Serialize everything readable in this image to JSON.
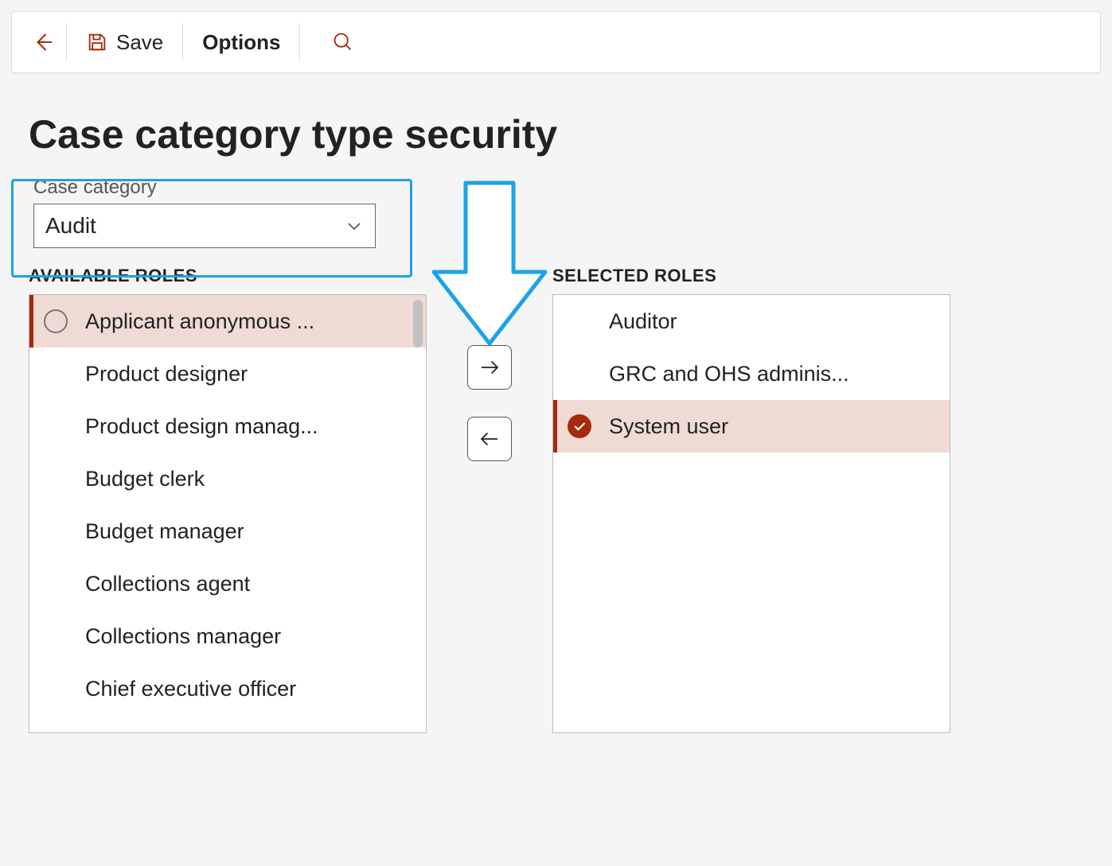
{
  "toolbar": {
    "save_label": "Save",
    "options_label": "Options"
  },
  "page": {
    "title": "Case category type security"
  },
  "field": {
    "label": "Case category",
    "value": "Audit"
  },
  "available": {
    "header": "AVAILABLE ROLES",
    "items": [
      "Applicant anonymous ...",
      "Product designer",
      "Product design manag...",
      "Budget clerk",
      "Budget manager",
      "Collections agent",
      "Collections manager",
      "Chief executive officer"
    ]
  },
  "selected": {
    "header": "SELECTED ROLES",
    "items": [
      "Auditor",
      "GRC and OHS adminis...",
      "System user"
    ]
  },
  "colors": {
    "accent": "#a52a0e",
    "highlight": "#1ba3e8"
  }
}
